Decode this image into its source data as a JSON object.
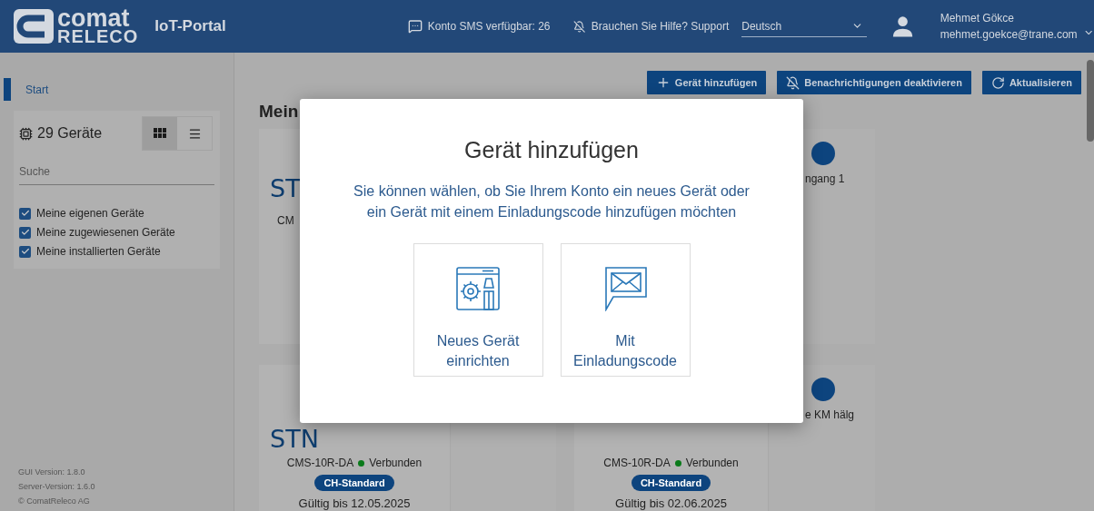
{
  "header": {
    "logo": {
      "line_1": "comat",
      "line_2": "RELECO"
    },
    "app_name": "IoT-Portal",
    "sms": "Konto SMS verfügbar: 26",
    "support": "Brauchen Sie Hilfe? Support",
    "language": {
      "value": "Deutsch"
    },
    "user": {
      "name": "Mehmet Gökce",
      "email": "mehmet.goekce@trane.com"
    }
  },
  "sidebar": {
    "nav": [
      {
        "label": "Start",
        "selected": true
      }
    ],
    "device_count": "29 Geräte",
    "view_toggle": [
      {
        "kind": "grid",
        "selected": true
      },
      {
        "kind": "list",
        "selected": false
      }
    ],
    "search": {
      "placeholder": "Suche"
    },
    "filters": [
      {
        "label": "Meine eigenen Geräte",
        "checked": true
      },
      {
        "label": "Meine zugewiesenen Geräte",
        "checked": true
      },
      {
        "label": "Meine installierten Geräte",
        "checked": true
      }
    ],
    "footer": [
      "GUI Version: 1.8.0",
      "Server-Version: 1.6.0",
      "© ComatReleco AG"
    ]
  },
  "toolbar": {
    "buttons": [
      {
        "kind": "add",
        "label": "Gerät hinzufügen"
      },
      {
        "kind": "mute",
        "label": "Benachrichtigungen deaktivieren"
      },
      {
        "kind": "refresh",
        "label": "Aktualisieren"
      }
    ]
  },
  "heading": "Mein",
  "card_rows": [
    [
      {
        "title": "ST",
        "model": "CM"
      },
      {
        "side": {
          "label": "ngang 1"
        }
      }
    ],
    [
      {
        "title": "STN",
        "model": "CMS-10R-DA",
        "status": "Verbunden",
        "connected": true,
        "badge": "CH-Standard",
        "valid_until": "Gültig bis 12.05.2025"
      },
      {
        "model": "CMS-10R-DA",
        "status": "Verbunden",
        "connected": true,
        "badge": "CH-Standard",
        "valid_until": "Gültig bis 02.06.2025",
        "side": {
          "label": "e KM hälg"
        }
      }
    ]
  ],
  "dialog": {
    "title": "Gerät hinzufügen",
    "description": "Sie können wählen, ob Sie Ihrem Konto ein neues Gerät oder ein Gerät mit einem Einladungscode hinzufügen möchten",
    "options": [
      {
        "kind": "setup",
        "label": "Neues Gerät einrichten"
      },
      {
        "kind": "invite",
        "label": "Mit Einladungscode"
      }
    ]
  }
}
